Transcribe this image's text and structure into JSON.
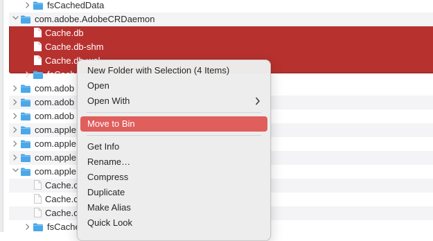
{
  "finder": {
    "rows": [
      {
        "label": "fsCachedData",
        "indent": 2,
        "type": "folder",
        "disclosure": "collapsed",
        "selected": false
      },
      {
        "label": "com.adobe.AdobeCRDaemon",
        "indent": 1,
        "type": "folder",
        "disclosure": "expanded",
        "selected": false
      },
      {
        "label": "Cache.db",
        "indent": 2,
        "type": "file",
        "disclosure": "none",
        "selected": true
      },
      {
        "label": "Cache.db-shm",
        "indent": 2,
        "type": "file",
        "disclosure": "none",
        "selected": true
      },
      {
        "label": "Cache.db-wal",
        "indent": 2,
        "type": "file",
        "disclosure": "none",
        "selected": true
      },
      {
        "label": "fsCache",
        "indent": 2,
        "type": "folder",
        "disclosure": "collapsed",
        "selected": true
      },
      {
        "label": "com.adob",
        "indent": 1,
        "type": "folder",
        "disclosure": "collapsed",
        "selected": false
      },
      {
        "label": "com.adob",
        "indent": 1,
        "type": "folder",
        "disclosure": "collapsed",
        "selected": false
      },
      {
        "label": "com.adob",
        "indent": 1,
        "type": "folder",
        "disclosure": "collapsed",
        "selected": false
      },
      {
        "label": "com.apple",
        "indent": 1,
        "type": "folder",
        "disclosure": "collapsed",
        "selected": false
      },
      {
        "label": "com.apple",
        "indent": 1,
        "type": "folder",
        "disclosure": "collapsed",
        "selected": false
      },
      {
        "label": "com.apple",
        "indent": 1,
        "type": "folder",
        "disclosure": "collapsed",
        "selected": false
      },
      {
        "label": "com.apple",
        "indent": 1,
        "type": "folder",
        "disclosure": "expanded",
        "selected": false
      },
      {
        "label": "Cache.c",
        "indent": 2,
        "type": "file",
        "disclosure": "none",
        "selected": false
      },
      {
        "label": "Cache.c",
        "indent": 2,
        "type": "file",
        "disclosure": "none",
        "selected": false
      },
      {
        "label": "Cache.c",
        "indent": 2,
        "type": "file",
        "disclosure": "none",
        "selected": false
      },
      {
        "label": "fsCache",
        "indent": 2,
        "type": "folder",
        "disclosure": "collapsed",
        "selected": false
      }
    ]
  },
  "context_menu": {
    "items": [
      {
        "label": "New Folder with Selection (4 Items)",
        "kind": "item"
      },
      {
        "label": "Open",
        "kind": "item"
      },
      {
        "label": "Open With",
        "kind": "submenu"
      },
      {
        "kind": "separator"
      },
      {
        "label": "Move to Bin",
        "kind": "item",
        "highlighted": true
      },
      {
        "kind": "separator"
      },
      {
        "label": "Get Info",
        "kind": "item"
      },
      {
        "label": "Rename…",
        "kind": "item"
      },
      {
        "label": "Compress",
        "kind": "item"
      },
      {
        "label": "Duplicate",
        "kind": "item"
      },
      {
        "label": "Make Alias",
        "kind": "item"
      },
      {
        "label": "Quick Look",
        "kind": "item"
      }
    ]
  },
  "colors": {
    "selection": "#b7312f",
    "menu_highlight": "#e05e5c",
    "folder": "#4aa8e8"
  }
}
